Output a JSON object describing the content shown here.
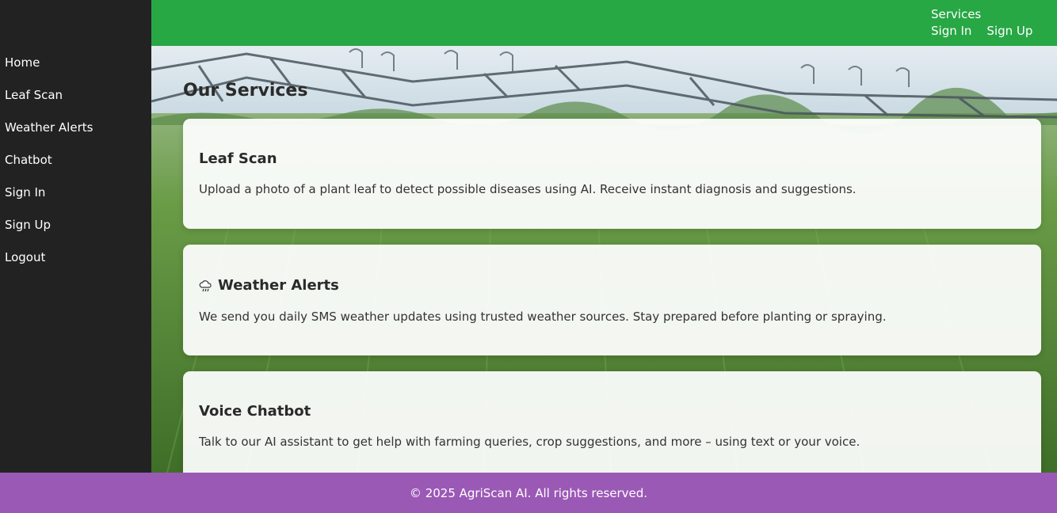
{
  "sidebar": {
    "items": [
      {
        "label": "Home"
      },
      {
        "label": "Leaf Scan"
      },
      {
        "label": "Weather Alerts"
      },
      {
        "label": "Chatbot"
      },
      {
        "label": "Sign In"
      },
      {
        "label": "Sign Up"
      },
      {
        "label": "Logout"
      }
    ]
  },
  "topnav": {
    "services": "Services",
    "sign_in": "Sign In",
    "sign_up": "Sign Up"
  },
  "main": {
    "title": "Our Services",
    "cards": [
      {
        "title": "Leaf Scan",
        "description": "Upload a photo of a plant leaf to detect possible diseases using AI. Receive instant diagnosis and suggestions."
      },
      {
        "icon": "weather-cloud-rain-icon",
        "title": "Weather Alerts",
        "description": "We send you daily SMS weather updates using trusted weather sources. Stay prepared before planting or spraying."
      },
      {
        "title": "Voice Chatbot",
        "description": "Talk to our AI assistant to get help with farming queries, crop suggestions, and more – using text or your voice."
      }
    ]
  },
  "footer": {
    "text": "© 2025 AgriScan AI. All rights reserved."
  },
  "colors": {
    "sidebar_bg": "#222222",
    "topbar_bg": "#28a745",
    "footer_bg": "#9b59b6"
  }
}
